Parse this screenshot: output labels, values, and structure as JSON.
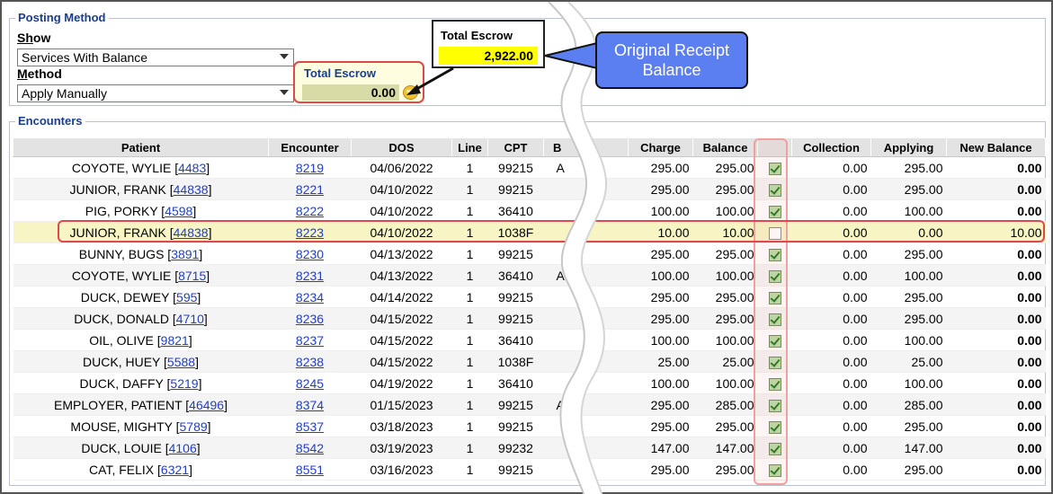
{
  "posting_method": {
    "title": "Posting Method",
    "show_label_u": "Sh",
    "show_label_rest": "ow",
    "show_value": "Services With Balance",
    "method_label_u": "M",
    "method_label_rest": "ethod",
    "method_value": "Apply Manually",
    "total_escrow_label": "Total Escrow",
    "total_escrow_value": "0.00"
  },
  "original_escrow": {
    "label": "Total Escrow",
    "value": "2,922.00"
  },
  "callout": {
    "text": "Original Receipt Balance"
  },
  "encounters": {
    "title": "Encounters",
    "columns": [
      "Patient",
      "Encounter",
      "DOS",
      "Line",
      "CPT",
      "B",
      "Charge",
      "Balance",
      "",
      "Collection",
      "Applying",
      "New Balance"
    ],
    "rows": [
      {
        "patient": "COYOTE, WYLIE",
        "pid": "4483",
        "enc": "8219",
        "dos": "04/06/2022",
        "line": "1",
        "cpt": "99215",
        "b": "A",
        "charge": "295.00",
        "balance": "295.00",
        "checked": true,
        "collection": "0.00",
        "applying": "295.00",
        "new_balance": "0.00"
      },
      {
        "patient": "JUNIOR, FRANK",
        "pid": "44838",
        "enc": "8221",
        "dos": "04/10/2022",
        "line": "1",
        "cpt": "99215",
        "b": "",
        "charge": "295.00",
        "balance": "295.00",
        "checked": true,
        "collection": "0.00",
        "applying": "295.00",
        "new_balance": "0.00"
      },
      {
        "patient": "PIG, PORKY",
        "pid": "4598",
        "enc": "8222",
        "dos": "04/10/2022",
        "line": "1",
        "cpt": "36410",
        "b": "",
        "charge": "100.00",
        "balance": "100.00",
        "checked": true,
        "collection": "0.00",
        "applying": "100.00",
        "new_balance": "0.00"
      },
      {
        "patient": "JUNIOR, FRANK",
        "pid": "44838",
        "enc": "8223",
        "dos": "04/10/2022",
        "line": "1",
        "cpt": "1038F",
        "b": "",
        "charge": "10.00",
        "balance": "10.00",
        "checked": false,
        "collection": "0.00",
        "applying": "0.00",
        "new_balance": "10.00"
      },
      {
        "patient": "BUNNY, BUGS",
        "pid": "3891",
        "enc": "8230",
        "dos": "04/13/2022",
        "line": "1",
        "cpt": "99215",
        "b": "",
        "charge": "295.00",
        "balance": "295.00",
        "checked": true,
        "collection": "0.00",
        "applying": "295.00",
        "new_balance": "0.00"
      },
      {
        "patient": "COYOTE, WYLIE",
        "pid": "8715",
        "enc": "8231",
        "dos": "04/13/2022",
        "line": "1",
        "cpt": "36410",
        "b": "A",
        "charge": "100.00",
        "balance": "100.00",
        "checked": true,
        "collection": "0.00",
        "applying": "100.00",
        "new_balance": "0.00"
      },
      {
        "patient": "DUCK, DEWEY",
        "pid": "595",
        "enc": "8234",
        "dos": "04/14/2022",
        "line": "1",
        "cpt": "99215",
        "b": "",
        "charge": "295.00",
        "balance": "295.00",
        "checked": true,
        "collection": "0.00",
        "applying": "295.00",
        "new_balance": "0.00"
      },
      {
        "patient": "DUCK, DONALD",
        "pid": "4710",
        "enc": "8236",
        "dos": "04/15/2022",
        "line": "1",
        "cpt": "99215",
        "b": "",
        "charge": "295.00",
        "balance": "295.00",
        "checked": true,
        "collection": "0.00",
        "applying": "295.00",
        "new_balance": "0.00"
      },
      {
        "patient": "OIL, OLIVE",
        "pid": "9821",
        "enc": "8237",
        "dos": "04/15/2022",
        "line": "1",
        "cpt": "36410",
        "b": "",
        "charge": "100.00",
        "balance": "100.00",
        "checked": true,
        "collection": "0.00",
        "applying": "100.00",
        "new_balance": "0.00"
      },
      {
        "patient": "DUCK, HUEY",
        "pid": "5588",
        "enc": "8238",
        "dos": "04/15/2022",
        "line": "1",
        "cpt": "1038F",
        "b": "",
        "charge": "25.00",
        "balance": "25.00",
        "checked": true,
        "collection": "0.00",
        "applying": "25.00",
        "new_balance": "0.00"
      },
      {
        "patient": "DUCK, DAFFY",
        "pid": "5219",
        "enc": "8245",
        "dos": "04/19/2022",
        "line": "1",
        "cpt": "36410",
        "b": "",
        "charge": "100.00",
        "balance": "100.00",
        "checked": true,
        "collection": "0.00",
        "applying": "100.00",
        "new_balance": "0.00"
      },
      {
        "patient": "EMPLOYER, PATIENT",
        "pid": "46496",
        "enc": "8374",
        "dos": "01/15/2023",
        "line": "1",
        "cpt": "99215",
        "b": "A",
        "charge": "295.00",
        "balance": "285.00",
        "checked": true,
        "collection": "0.00",
        "applying": "285.00",
        "new_balance": "0.00"
      },
      {
        "patient": "MOUSE, MIGHTY",
        "pid": "5789",
        "enc": "8537",
        "dos": "03/18/2023",
        "line": "1",
        "cpt": "99215",
        "b": "",
        "charge": "295.00",
        "balance": "295.00",
        "checked": true,
        "collection": "0.00",
        "applying": "295.00",
        "new_balance": "0.00"
      },
      {
        "patient": "DUCK, LOUIE",
        "pid": "4106",
        "enc": "8542",
        "dos": "03/19/2023",
        "line": "1",
        "cpt": "99232",
        "b": "",
        "charge": "147.00",
        "balance": "147.00",
        "checked": true,
        "collection": "0.00",
        "applying": "147.00",
        "new_balance": "0.00"
      },
      {
        "patient": "CAT, FELIX",
        "pid": "6321",
        "enc": "8551",
        "dos": "03/16/2023",
        "line": "1",
        "cpt": "99215",
        "b": "",
        "charge": "295.00",
        "balance": "295.00",
        "checked": true,
        "collection": "0.00",
        "applying": "295.00",
        "new_balance": "0.00"
      }
    ]
  },
  "colors": {
    "accent_title": "#1a3d8f",
    "link": "#1f3fc4",
    "highlight_red": "#e0484a",
    "callout_blue": "#5b7ff0",
    "escrow_yellow": "#ffff00"
  }
}
